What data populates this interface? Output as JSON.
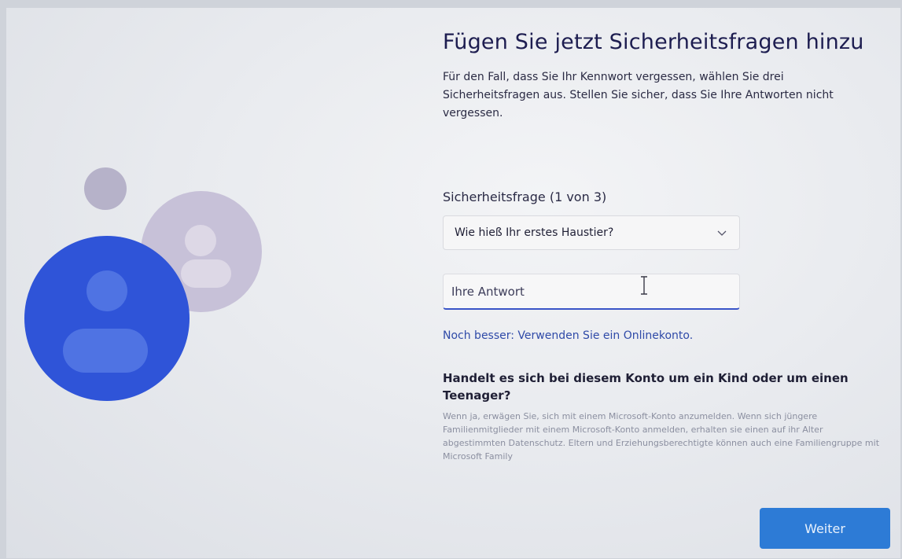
{
  "heading": "Fügen Sie jetzt Sicherheitsfragen hinzu",
  "description": "Für den Fall, dass Sie Ihr Kennwort vergessen, wählen Sie drei Sicherheitsfragen aus. Stellen Sie sicher, dass Sie Ihre Antworten nicht vergessen.",
  "question_label": "Sicherheitsfrage (1 von 3)",
  "question_select": {
    "selected": "Wie hieß Ihr erstes Haustier?"
  },
  "answer_input": {
    "placeholder": "Ihre Antwort",
    "value": ""
  },
  "online_account_link": "Noch besser: Verwenden Sie ein Onlinekonto.",
  "child_section": {
    "title": "Handelt es sich bei diesem Konto um ein Kind oder um einen Teenager?",
    "body": "Wenn ja, erwägen Sie, sich mit einem Microsoft-Konto anzumelden. Wenn sich jüngere Familienmitglieder mit einem Microsoft-Konto anmelden, erhalten sie einen auf ihr Alter abgestimmten Datenschutz. Eltern und Erziehungsberechtigte können auch eine Familiengruppe mit Microsoft Family"
  },
  "next_button": "Weiter",
  "colors": {
    "accent": "#2d7bd6",
    "avatar_blue": "#2f54d8",
    "avatar_lilac": "#b9b1cc",
    "link": "#2f4aa8"
  }
}
